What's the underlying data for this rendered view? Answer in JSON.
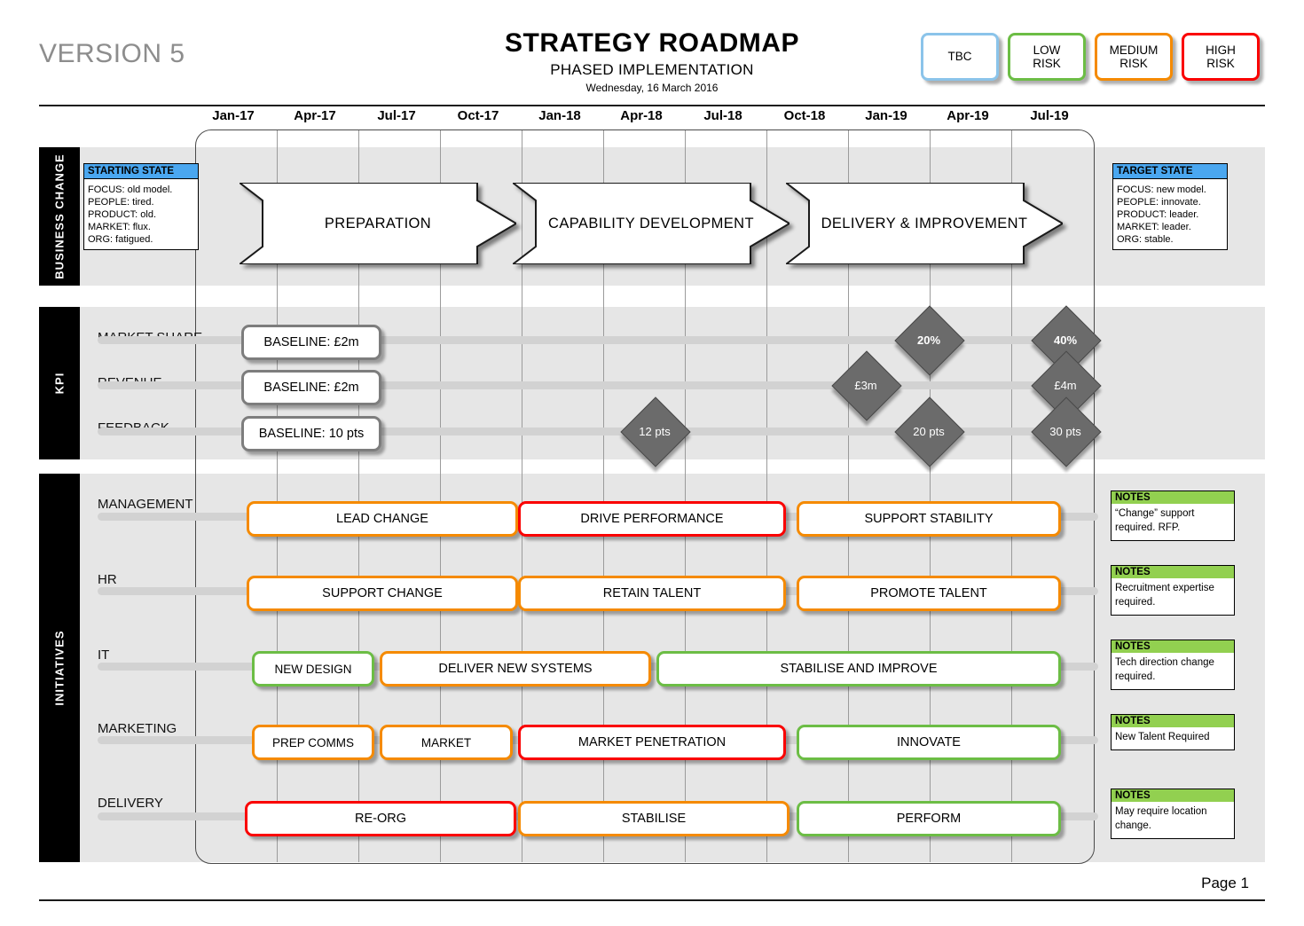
{
  "header": {
    "version": "VERSION 5",
    "title": "STRATEGY ROADMAP",
    "subtitle": "PHASED IMPLEMENTATION",
    "date": "Wednesday, 16 March 2016",
    "page": "Page 1"
  },
  "legend": [
    {
      "label": "TBC",
      "color": "#8bc4ea",
      "key": "tbc"
    },
    {
      "label": "LOW\nRISK",
      "line1": "LOW",
      "line2": "RISK",
      "color": "#6cbd45",
      "key": "low"
    },
    {
      "label": "MEDIUM\nRISK",
      "line1": "MEDIUM",
      "line2": "RISK",
      "color": "#f58a00",
      "key": "medium"
    },
    {
      "label": "HIGH\nRISK",
      "line1": "HIGH",
      "line2": "RISK",
      "color": "#fa0000",
      "key": "high"
    }
  ],
  "timeline": {
    "ticks": [
      "Jan-17",
      "Apr-17",
      "Jul-17",
      "Oct-17",
      "Jan-18",
      "Apr-18",
      "Jul-18",
      "Oct-18",
      "Jan-19",
      "Apr-19",
      "Jul-19"
    ]
  },
  "sections": {
    "business_change": {
      "label": "BUSINESS CHANGE",
      "starting_state": {
        "title": "STARTING STATE",
        "lines": [
          "FOCUS: old model.",
          "PEOPLE: tired.",
          "PRODUCT: old.",
          "MARKET: flux.",
          "ORG: fatigued."
        ]
      },
      "target_state": {
        "title": "TARGET STATE",
        "lines": [
          "FOCUS: new  model.",
          "PEOPLE: innovate.",
          "PRODUCT: leader.",
          "MARKET: leader.",
          "ORG: stable."
        ]
      },
      "phases": [
        {
          "label": "PREPARATION"
        },
        {
          "label": "CAPABILITY DEVELOPMENT"
        },
        {
          "label": "DELIVERY & IMPROVEMENT"
        }
      ]
    },
    "kpi": {
      "label": "KPI",
      "rows": [
        {
          "name": "MARKET SHARE",
          "baseline": "BASELINE: £2m",
          "milestones": [
            {
              "value": "20%",
              "bold": true
            },
            {
              "value": "40%",
              "bold": true
            }
          ]
        },
        {
          "name": "REVENUE",
          "baseline": "BASELINE: £2m",
          "milestones": [
            {
              "value": "£3m",
              "bold": false
            },
            {
              "value": "£4m",
              "bold": false
            }
          ]
        },
        {
          "name": "FEEDBACK",
          "baseline": "BASELINE: 10 pts",
          "milestones": [
            {
              "value": "12 pts",
              "bold": false
            },
            {
              "value": "20 pts",
              "bold": false
            },
            {
              "value": "30 pts",
              "bold": false
            }
          ]
        }
      ]
    },
    "initiatives": {
      "label": "INITIATIVES",
      "rows": [
        {
          "name": "MANAGEMENT",
          "items": [
            {
              "label": "LEAD CHANGE",
              "risk": "orange"
            },
            {
              "label": "DRIVE PERFORMANCE",
              "risk": "red"
            },
            {
              "label": "SUPPORT STABILITY",
              "risk": "orange"
            }
          ],
          "note": {
            "title": "NOTES",
            "text": "“Change” support required. RFP."
          }
        },
        {
          "name": "HR",
          "items": [
            {
              "label": "SUPPORT CHANGE",
              "risk": "orange"
            },
            {
              "label": "RETAIN TALENT",
              "risk": "orange"
            },
            {
              "label": "PROMOTE TALENT",
              "risk": "orange"
            }
          ],
          "note": {
            "title": "NOTES",
            "text": "Recruitment expertise required."
          }
        },
        {
          "name": "IT",
          "items": [
            {
              "label": "NEW DESIGN",
              "risk": "green"
            },
            {
              "label": "DELIVER NEW SYSTEMS",
              "risk": "orange"
            },
            {
              "label": "STABILISE AND IMPROVE",
              "risk": "green"
            }
          ],
          "note": {
            "title": "NOTES",
            "text": "Tech direction change required."
          }
        },
        {
          "name": "MARKETING",
          "items": [
            {
              "label": "PREP COMMS",
              "risk": "orange"
            },
            {
              "label": "MARKET",
              "risk": "orange"
            },
            {
              "label": "MARKET PENETRATION",
              "risk": "red"
            },
            {
              "label": "INNOVATE",
              "risk": "green"
            }
          ],
          "note": {
            "title": "NOTES",
            "text": "New Talent Required"
          }
        },
        {
          "name": "DELIVERY",
          "items": [
            {
              "label": "RE-ORG",
              "risk": "red"
            },
            {
              "label": "STABILISE",
              "risk": "orange"
            },
            {
              "label": "PERFORM",
              "risk": "green"
            }
          ],
          "note": {
            "title": "NOTES",
            "text": "May require location change."
          }
        }
      ]
    }
  }
}
